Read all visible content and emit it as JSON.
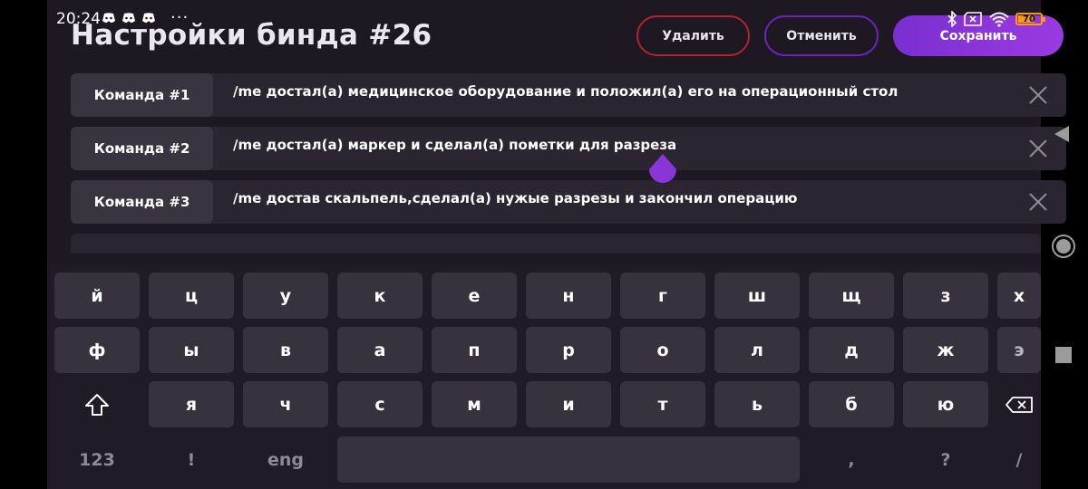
{
  "statusbar": {
    "time": "20:24",
    "more": "···",
    "battery": "70",
    "battery_level": 0.7
  },
  "header": {
    "title": "Настройки бинда #26",
    "delete_label": "Удалить",
    "cancel_label": "Отменить",
    "save_label": "Сохранить"
  },
  "commands": [
    {
      "label": "Команда #1",
      "text": "/me достал(а) медицинское оборудование и положил(а) его на операционный стол"
    },
    {
      "label": "Команда #2",
      "text": "/me достал(а) маркер и сделал(а) пометки для разреза"
    },
    {
      "label": "Команда #3",
      "text": "/me достав скальпель,сделал(а) нужые разрезы и закончил операцию"
    }
  ],
  "keyboard": {
    "row1": [
      "й",
      "ц",
      "у",
      "к",
      "е",
      "н",
      "г",
      "ш",
      "щ",
      "з",
      "х"
    ],
    "row2": [
      "ф",
      "ы",
      "в",
      "а",
      "п",
      "р",
      "о",
      "л",
      "д",
      "ж",
      "э"
    ],
    "row3": [
      "я",
      "ч",
      "с",
      "м",
      "и",
      "т",
      "ь",
      "б",
      "ю"
    ],
    "bottom": {
      "numbers": "123",
      "exclaim": "!",
      "lang": "eng",
      "comma": ",",
      "question": "?",
      "slash": "/"
    }
  },
  "colors": {
    "accent": "#8a35d8",
    "delete_border": "#b3222d",
    "cancel_border": "#6a25b8",
    "battery": "#ff9d00"
  },
  "icons": [
    "discord-icon",
    "close-icon",
    "shift-icon",
    "backspace-icon",
    "bluetooth-icon",
    "wifi-icon",
    "sim-icon",
    "battery-icon",
    "nav-back-icon",
    "nav-home-icon",
    "nav-recent-icon",
    "text-cursor-handle-icon"
  ]
}
